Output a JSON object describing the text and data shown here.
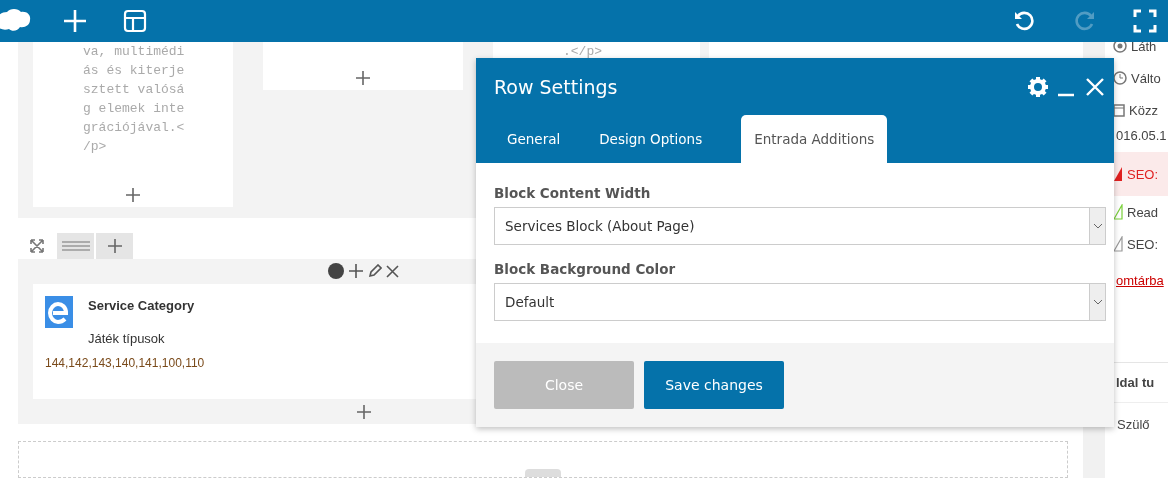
{
  "toolbar": {
    "redo": {
      "disabled": true
    }
  },
  "editor": {
    "top_row": {
      "cards": [
        {
          "kind": "text",
          "lines": [
            "va, multimédi",
            "ás és kiterje",
            "sztett valósá",
            "g elemek inte",
            "grációjával.<",
            "/p>"
          ]
        },
        {
          "kind": "empty"
        },
        {
          "kind": "text",
          "lines": [
            ".</p>"
          ]
        },
        {
          "kind": "blank"
        }
      ]
    },
    "element": {
      "title": "Service Category",
      "subtitle": "Játék típusok",
      "ids": "144,142,143,140,141,100,110"
    }
  },
  "sidebar": {
    "items": [
      {
        "kind": "eye",
        "text": "Láth"
      },
      {
        "kind": "history",
        "text": "Válto"
      },
      {
        "kind": "calendar",
        "text": "Közz"
      },
      {
        "kind": "plain",
        "text": "016.05.1"
      },
      {
        "kind": "seo-alert",
        "text": "SEO:"
      },
      {
        "kind": "readability",
        "text": "Read"
      },
      {
        "kind": "seo",
        "text": "SEO:"
      },
      {
        "kind": "link",
        "text": "omtárba"
      }
    ],
    "section_title": "ldal tu",
    "field_label": "Szülő"
  },
  "modal": {
    "title": "Row Settings",
    "tabs": [
      {
        "label": "General",
        "selected": false
      },
      {
        "label": "Design Options",
        "selected": false
      },
      {
        "label": "Entrada Additions",
        "selected": true
      }
    ],
    "fields": [
      {
        "label": "Block Content Width",
        "value": "Services Block (About Page)"
      },
      {
        "label": "Block Background Color",
        "value": "Default"
      }
    ],
    "buttons": [
      {
        "label": "Close",
        "kind": "secondary"
      },
      {
        "label": "Save changes",
        "kind": "primary"
      }
    ]
  }
}
